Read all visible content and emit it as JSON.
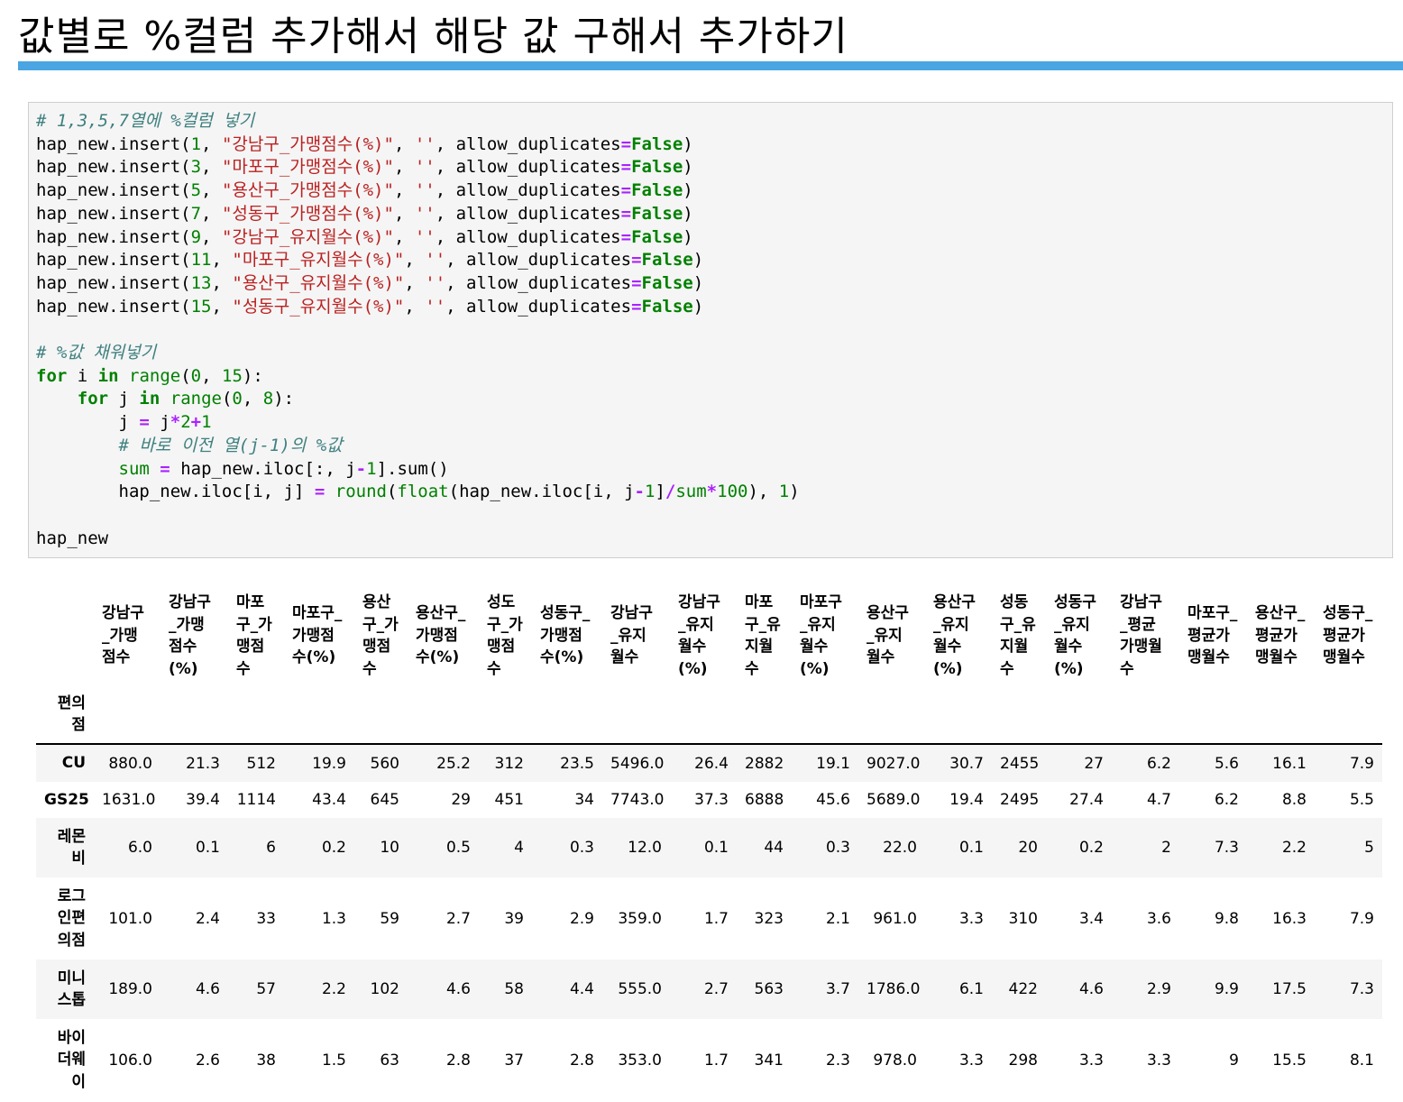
{
  "page": {
    "title": "값별로 %컬럼 추가해서 해당 값 구해서 추가하기"
  },
  "code": {
    "lines": [
      [
        {
          "t": "cm",
          "v": "# 1,3,5,7열에 %컬럼 넣기"
        }
      ],
      [
        {
          "t": "fn",
          "v": "hap_new.insert("
        },
        {
          "t": "nu",
          "v": "1"
        },
        {
          "t": "fn",
          "v": ", "
        },
        {
          "t": "st",
          "v": "\"강남구_가맹점수(%)\""
        },
        {
          "t": "fn",
          "v": ", "
        },
        {
          "t": "st",
          "v": "''"
        },
        {
          "t": "fn",
          "v": ", allow_duplicates"
        },
        {
          "t": "op",
          "v": "="
        },
        {
          "t": "kw",
          "v": "False"
        },
        {
          "t": "fn",
          "v": ")"
        }
      ],
      [
        {
          "t": "fn",
          "v": "hap_new.insert("
        },
        {
          "t": "nu",
          "v": "3"
        },
        {
          "t": "fn",
          "v": ", "
        },
        {
          "t": "st",
          "v": "\"마포구_가맹점수(%)\""
        },
        {
          "t": "fn",
          "v": ", "
        },
        {
          "t": "st",
          "v": "''"
        },
        {
          "t": "fn",
          "v": ", allow_duplicates"
        },
        {
          "t": "op",
          "v": "="
        },
        {
          "t": "kw",
          "v": "False"
        },
        {
          "t": "fn",
          "v": ")"
        }
      ],
      [
        {
          "t": "fn",
          "v": "hap_new.insert("
        },
        {
          "t": "nu",
          "v": "5"
        },
        {
          "t": "fn",
          "v": ", "
        },
        {
          "t": "st",
          "v": "\"용산구_가맹점수(%)\""
        },
        {
          "t": "fn",
          "v": ", "
        },
        {
          "t": "st",
          "v": "''"
        },
        {
          "t": "fn",
          "v": ", allow_duplicates"
        },
        {
          "t": "op",
          "v": "="
        },
        {
          "t": "kw",
          "v": "False"
        },
        {
          "t": "fn",
          "v": ")"
        }
      ],
      [
        {
          "t": "fn",
          "v": "hap_new.insert("
        },
        {
          "t": "nu",
          "v": "7"
        },
        {
          "t": "fn",
          "v": ", "
        },
        {
          "t": "st",
          "v": "\"성동구_가맹점수(%)\""
        },
        {
          "t": "fn",
          "v": ", "
        },
        {
          "t": "st",
          "v": "''"
        },
        {
          "t": "fn",
          "v": ", allow_duplicates"
        },
        {
          "t": "op",
          "v": "="
        },
        {
          "t": "kw",
          "v": "False"
        },
        {
          "t": "fn",
          "v": ")"
        }
      ],
      [
        {
          "t": "fn",
          "v": "hap_new.insert("
        },
        {
          "t": "nu",
          "v": "9"
        },
        {
          "t": "fn",
          "v": ", "
        },
        {
          "t": "st",
          "v": "\"강남구_유지월수(%)\""
        },
        {
          "t": "fn",
          "v": ", "
        },
        {
          "t": "st",
          "v": "''"
        },
        {
          "t": "fn",
          "v": ", allow_duplicates"
        },
        {
          "t": "op",
          "v": "="
        },
        {
          "t": "kw",
          "v": "False"
        },
        {
          "t": "fn",
          "v": ")"
        }
      ],
      [
        {
          "t": "fn",
          "v": "hap_new.insert("
        },
        {
          "t": "nu",
          "v": "11"
        },
        {
          "t": "fn",
          "v": ", "
        },
        {
          "t": "st",
          "v": "\"마포구_유지월수(%)\""
        },
        {
          "t": "fn",
          "v": ", "
        },
        {
          "t": "st",
          "v": "''"
        },
        {
          "t": "fn",
          "v": ", allow_duplicates"
        },
        {
          "t": "op",
          "v": "="
        },
        {
          "t": "kw",
          "v": "False"
        },
        {
          "t": "fn",
          "v": ")"
        }
      ],
      [
        {
          "t": "fn",
          "v": "hap_new.insert("
        },
        {
          "t": "nu",
          "v": "13"
        },
        {
          "t": "fn",
          "v": ", "
        },
        {
          "t": "st",
          "v": "\"용산구_유지월수(%)\""
        },
        {
          "t": "fn",
          "v": ", "
        },
        {
          "t": "st",
          "v": "''"
        },
        {
          "t": "fn",
          "v": ", allow_duplicates"
        },
        {
          "t": "op",
          "v": "="
        },
        {
          "t": "kw",
          "v": "False"
        },
        {
          "t": "fn",
          "v": ")"
        }
      ],
      [
        {
          "t": "fn",
          "v": "hap_new.insert("
        },
        {
          "t": "nu",
          "v": "15"
        },
        {
          "t": "fn",
          "v": ", "
        },
        {
          "t": "st",
          "v": "\"성동구_유지월수(%)\""
        },
        {
          "t": "fn",
          "v": ", "
        },
        {
          "t": "st",
          "v": "''"
        },
        {
          "t": "fn",
          "v": ", allow_duplicates"
        },
        {
          "t": "op",
          "v": "="
        },
        {
          "t": "kw",
          "v": "False"
        },
        {
          "t": "fn",
          "v": ")"
        }
      ],
      [],
      [
        {
          "t": "cm",
          "v": "# %값 채워넣기"
        }
      ],
      [
        {
          "t": "kw",
          "v": "for"
        },
        {
          "t": "fn",
          "v": " i "
        },
        {
          "t": "kw",
          "v": "in"
        },
        {
          "t": "fn",
          "v": " "
        },
        {
          "t": "bi",
          "v": "range"
        },
        {
          "t": "fn",
          "v": "("
        },
        {
          "t": "nu",
          "v": "0"
        },
        {
          "t": "fn",
          "v": ", "
        },
        {
          "t": "nu",
          "v": "15"
        },
        {
          "t": "fn",
          "v": "):"
        }
      ],
      [
        {
          "t": "fn",
          "v": "    "
        },
        {
          "t": "kw",
          "v": "for"
        },
        {
          "t": "fn",
          "v": " j "
        },
        {
          "t": "kw",
          "v": "in"
        },
        {
          "t": "fn",
          "v": " "
        },
        {
          "t": "bi",
          "v": "range"
        },
        {
          "t": "fn",
          "v": "("
        },
        {
          "t": "nu",
          "v": "0"
        },
        {
          "t": "fn",
          "v": ", "
        },
        {
          "t": "nu",
          "v": "8"
        },
        {
          "t": "fn",
          "v": "):"
        }
      ],
      [
        {
          "t": "fn",
          "v": "        j "
        },
        {
          "t": "op",
          "v": "="
        },
        {
          "t": "fn",
          "v": " j"
        },
        {
          "t": "op",
          "v": "*"
        },
        {
          "t": "nu",
          "v": "2"
        },
        {
          "t": "op",
          "v": "+"
        },
        {
          "t": "nu",
          "v": "1"
        }
      ],
      [
        {
          "t": "fn",
          "v": "        "
        },
        {
          "t": "cm",
          "v": "# 바로 이전 열(j-1)의 %값"
        }
      ],
      [
        {
          "t": "fn",
          "v": "        "
        },
        {
          "t": "bi",
          "v": "sum"
        },
        {
          "t": "fn",
          "v": " "
        },
        {
          "t": "op",
          "v": "="
        },
        {
          "t": "fn",
          "v": " hap_new.iloc[:, j"
        },
        {
          "t": "op",
          "v": "-"
        },
        {
          "t": "nu",
          "v": "1"
        },
        {
          "t": "fn",
          "v": "].sum()"
        }
      ],
      [
        {
          "t": "fn",
          "v": "        hap_new.iloc[i, j] "
        },
        {
          "t": "op",
          "v": "="
        },
        {
          "t": "fn",
          "v": " "
        },
        {
          "t": "bi",
          "v": "round"
        },
        {
          "t": "fn",
          "v": "("
        },
        {
          "t": "bi",
          "v": "float"
        },
        {
          "t": "fn",
          "v": "(hap_new.iloc[i, j"
        },
        {
          "t": "op",
          "v": "-"
        },
        {
          "t": "nu",
          "v": "1"
        },
        {
          "t": "fn",
          "v": "]"
        },
        {
          "t": "op",
          "v": "/"
        },
        {
          "t": "bi",
          "v": "sum"
        },
        {
          "t": "op",
          "v": "*"
        },
        {
          "t": "nu",
          "v": "100"
        },
        {
          "t": "fn",
          "v": "), "
        },
        {
          "t": "nu",
          "v": "1"
        },
        {
          "t": "fn",
          "v": ")"
        }
      ],
      [],
      [
        {
          "t": "fn",
          "v": "hap_new"
        }
      ]
    ]
  },
  "table": {
    "columns": [
      "강남구\n_가맹\n점수",
      "강남구\n_가맹\n점수\n(%)",
      "마포\n구_가\n맹점\n수",
      "마포구_\n가맹점\n수(%)",
      "용산\n구_가\n맹점\n수",
      "용산구_\n가맹점\n수(%)",
      "성도\n구_가\n맹점\n수",
      "성동구_\n가맹점\n수(%)",
      "강남구\n_유지\n월수",
      "강남구\n_유지\n월수\n(%)",
      "마포\n구_유\n지월\n수",
      "마포구\n_유지\n월수\n(%)",
      "용산구\n_유지\n월수",
      "용산구\n_유지\n월수\n(%)",
      "성동\n구_유\n지월\n수",
      "성동구\n_유지\n월수\n(%)",
      "강남구\n_평균\n가맹월\n수",
      "마포구_\n평균가\n맹월수",
      "용산구_\n평균가\n맹월수",
      "성동구_\n평균가\n맹월수"
    ],
    "index_name": "편의\n점",
    "rows": [
      {
        "label": "CU",
        "values": [
          "880.0",
          "21.3",
          "512",
          "19.9",
          "560",
          "25.2",
          "312",
          "23.5",
          "5496.0",
          "26.4",
          "2882",
          "19.1",
          "9027.0",
          "30.7",
          "2455",
          "27",
          "6.2",
          "5.6",
          "16.1",
          "7.9"
        ]
      },
      {
        "label": "GS25",
        "values": [
          "1631.0",
          "39.4",
          "1114",
          "43.4",
          "645",
          "29",
          "451",
          "34",
          "7743.0",
          "37.3",
          "6888",
          "45.6",
          "5689.0",
          "19.4",
          "2495",
          "27.4",
          "4.7",
          "6.2",
          "8.8",
          "5.5"
        ]
      },
      {
        "label": "레몬\n비",
        "values": [
          "6.0",
          "0.1",
          "6",
          "0.2",
          "10",
          "0.5",
          "4",
          "0.3",
          "12.0",
          "0.1",
          "44",
          "0.3",
          "22.0",
          "0.1",
          "20",
          "0.2",
          "2",
          "7.3",
          "2.2",
          "5"
        ]
      },
      {
        "label": "로그\n인편\n의점",
        "values": [
          "101.0",
          "2.4",
          "33",
          "1.3",
          "59",
          "2.7",
          "39",
          "2.9",
          "359.0",
          "1.7",
          "323",
          "2.1",
          "961.0",
          "3.3",
          "310",
          "3.4",
          "3.6",
          "9.8",
          "16.3",
          "7.9"
        ]
      },
      {
        "label": "미니\n스톱",
        "values": [
          "189.0",
          "4.6",
          "57",
          "2.2",
          "102",
          "4.6",
          "58",
          "4.4",
          "555.0",
          "2.7",
          "563",
          "3.7",
          "1786.0",
          "6.1",
          "422",
          "4.6",
          "2.9",
          "9.9",
          "17.5",
          "7.3"
        ]
      },
      {
        "label": "바이\n더웨\n이",
        "values": [
          "106.0",
          "2.6",
          "38",
          "1.5",
          "63",
          "2.8",
          "37",
          "2.8",
          "353.0",
          "1.7",
          "341",
          "2.3",
          "978.0",
          "3.3",
          "298",
          "3.3",
          "3.3",
          "9",
          "15.5",
          "8.1"
        ]
      }
    ]
  }
}
